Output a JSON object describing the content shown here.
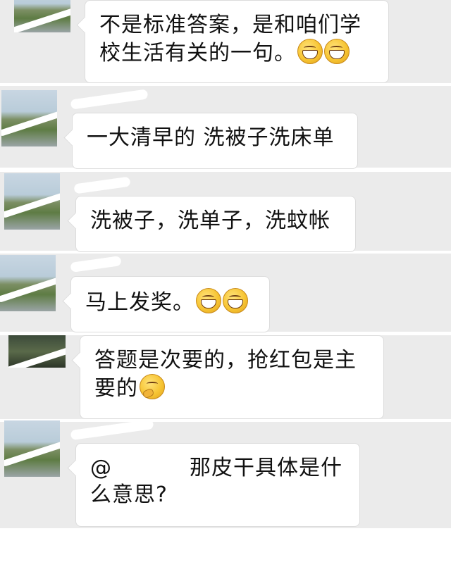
{
  "messages": [
    {
      "text": "不是标准答案，是和咱们学校生活有关的一句。",
      "emoji": [
        "grinning-face",
        "grinning-face"
      ]
    },
    {
      "text": "一大清早的 洗被子洗床单",
      "emoji": []
    },
    {
      "text": "洗被子，洗单子，洗蚊帐",
      "emoji": []
    },
    {
      "text": "马上发奖。",
      "emoji": [
        "grinning-face",
        "grinning-face"
      ]
    },
    {
      "text": "答题是次要的，抢红包是主要的",
      "emoji": [
        "thinking-face"
      ]
    },
    {
      "mention": "@",
      "text": "那皮干具体是什么意思?",
      "emoji": []
    }
  ],
  "colors": {
    "chat_background": "#ebebeb",
    "bubble": "#ffffff",
    "text": "#111111"
  }
}
